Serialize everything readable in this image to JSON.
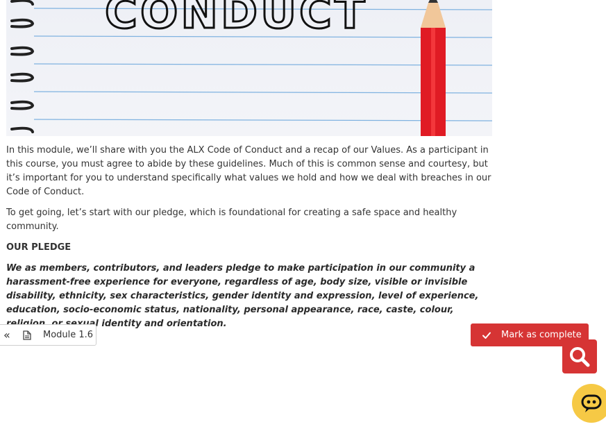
{
  "hero": {
    "word": "CONDUCT"
  },
  "content": {
    "intro": "In this module, we’ll share with you the ALX Code of Conduct and a recap of our Values. As a participant in this course, you must agree to abide by these guidelines. Much of this is common sense and courtesy, but it’s important for you to understand specifically what values we hold and how we deal with breaches in our Code of Conduct.",
    "lead": "To get going, let’s start with our pledge, which is foundational for creating a safe space and healthy community.",
    "heading": "OUR PLEDGE",
    "pledge": "We as members, contributors, and leaders pledge to make participation in our community a harassment-free experience for everyone, regardless of age, body size, visible or invisible disability, ethnicity, sex characteristics, gender identity and expression, level of experience, education, socio-economic status, nationality, personal appearance, race, caste, colour, religion, or sexual identity and orientation."
  },
  "nav": {
    "prev_label": "Module 1.6",
    "complete_label": "Mark as complete"
  },
  "colors": {
    "accent": "#d63434",
    "chat": "#f6c945"
  },
  "icons": {
    "prev": "double-chevron-left-icon",
    "doc": "document-icon",
    "check": "check-icon",
    "search": "search-icon",
    "chat": "chat-bot-icon"
  }
}
